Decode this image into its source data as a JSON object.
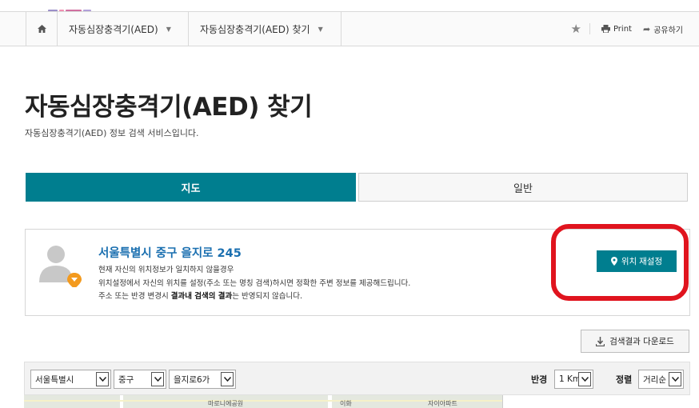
{
  "nav": {
    "home_icon": "home-icon",
    "dropdown1": "자동심장충격기(AED)",
    "dropdown2": "자동심장충격기(AED) 찾기",
    "print": "Print",
    "share": "공유하기"
  },
  "page": {
    "title": "자동심장충격기(AED) 찾기",
    "subtitle": "자동심장충격기(AED) 정보 검색 서비스입니다."
  },
  "tabs": [
    {
      "label": "지도",
      "active": true
    },
    {
      "label": "일반",
      "active": false
    }
  ],
  "location": {
    "address": "서울특별시 중구 을지로 245",
    "line1": "현재 자신의 위치정보가 일치하지 않을경우",
    "line2": "위치설정에서 자신의 위치를 설정(주소 또는 명칭 검색)하시면 정확한 주변 정보를 제공해드립니다.",
    "line3_pre": "주소 또는 반경 변경시 ",
    "line3_bold": "결과내 검색의 결과",
    "line3_post": "는 반영되지 않습니다.",
    "reset_button": "위치 재설정"
  },
  "download_button": "검색결과 다운로드",
  "filters": {
    "sido": "서울특별시",
    "gugun": "중구",
    "dong": "을지로6가",
    "radius_label": "반경",
    "radius": "1 Km",
    "sort_label": "정렬",
    "sort": "거리순"
  },
  "map_labels": [
    "마로니에공원",
    "이화",
    "자이아파트"
  ],
  "colors": {
    "accent": "#007e8f",
    "link": "#1a6fb0",
    "highlight": "#e0141e",
    "pin": "#f39a1e"
  }
}
